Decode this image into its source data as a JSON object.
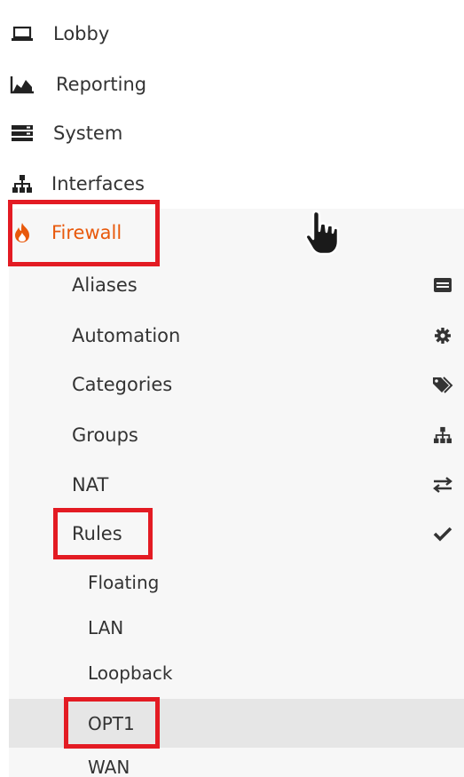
{
  "nav": {
    "top_items": [
      {
        "label": "Lobby",
        "icon": "laptop-icon"
      },
      {
        "label": "Reporting",
        "icon": "area-chart-icon"
      },
      {
        "label": "System",
        "icon": "server-icon"
      },
      {
        "label": "Interfaces",
        "icon": "sitemap-icon"
      },
      {
        "label": "Firewall",
        "icon": "fire-icon"
      }
    ],
    "firewall_items": [
      {
        "label": "Aliases",
        "icon": "list-alt-icon"
      },
      {
        "label": "Automation",
        "icon": "gear-icon"
      },
      {
        "label": "Categories",
        "icon": "tags-icon"
      },
      {
        "label": "Groups",
        "icon": "sitemap-icon"
      },
      {
        "label": "NAT",
        "icon": "exchange-icon"
      },
      {
        "label": "Rules",
        "icon": "check-icon"
      }
    ],
    "rules_items": [
      {
        "label": "Floating"
      },
      {
        "label": "LAN"
      },
      {
        "label": "Loopback"
      },
      {
        "label": "OPT1"
      },
      {
        "label": "WAN"
      }
    ],
    "active_item": "OPT1"
  },
  "colors": {
    "active_section": "#e8590c",
    "highlight_box": "#e31b23",
    "submenu_background": "#f7f7f7",
    "active_row_background": "#e6e6e6"
  }
}
